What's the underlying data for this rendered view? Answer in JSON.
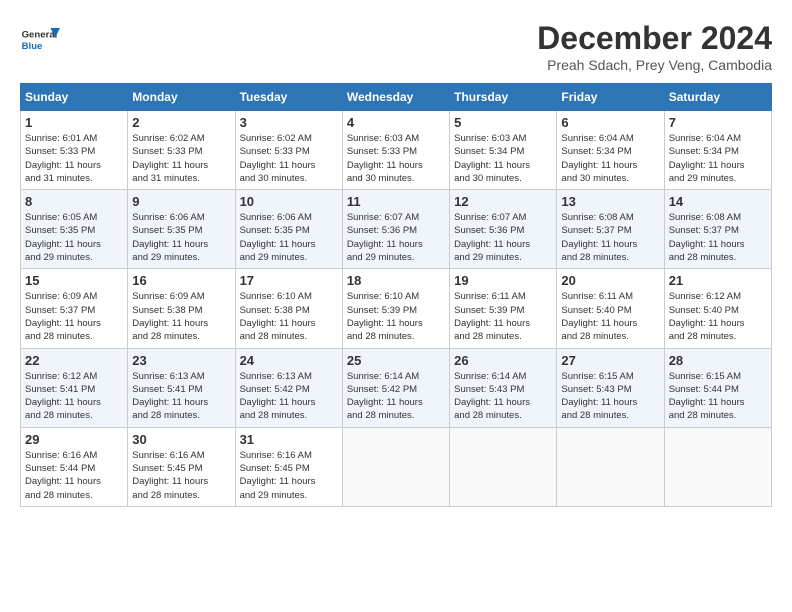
{
  "header": {
    "logo_general": "General",
    "logo_blue": "Blue",
    "title": "December 2024",
    "subtitle": "Preah Sdach, Prey Veng, Cambodia"
  },
  "calendar": {
    "days_of_week": [
      "Sunday",
      "Monday",
      "Tuesday",
      "Wednesday",
      "Thursday",
      "Friday",
      "Saturday"
    ],
    "weeks": [
      [
        {
          "day": "",
          "info": ""
        },
        {
          "day": "2",
          "info": "Sunrise: 6:02 AM\nSunset: 5:33 PM\nDaylight: 11 hours\nand 31 minutes."
        },
        {
          "day": "3",
          "info": "Sunrise: 6:02 AM\nSunset: 5:33 PM\nDaylight: 11 hours\nand 30 minutes."
        },
        {
          "day": "4",
          "info": "Sunrise: 6:03 AM\nSunset: 5:33 PM\nDaylight: 11 hours\nand 30 minutes."
        },
        {
          "day": "5",
          "info": "Sunrise: 6:03 AM\nSunset: 5:34 PM\nDaylight: 11 hours\nand 30 minutes."
        },
        {
          "day": "6",
          "info": "Sunrise: 6:04 AM\nSunset: 5:34 PM\nDaylight: 11 hours\nand 30 minutes."
        },
        {
          "day": "7",
          "info": "Sunrise: 6:04 AM\nSunset: 5:34 PM\nDaylight: 11 hours\nand 29 minutes."
        }
      ],
      [
        {
          "day": "1",
          "info": "Sunrise: 6:01 AM\nSunset: 5:33 PM\nDaylight: 11 hours\nand 31 minutes."
        },
        {
          "day": "",
          "info": ""
        },
        {
          "day": "",
          "info": ""
        },
        {
          "day": "",
          "info": ""
        },
        {
          "day": "",
          "info": ""
        },
        {
          "day": "",
          "info": ""
        },
        {
          "day": "",
          "info": ""
        }
      ],
      [
        {
          "day": "8",
          "info": "Sunrise: 6:05 AM\nSunset: 5:35 PM\nDaylight: 11 hours\nand 29 minutes."
        },
        {
          "day": "9",
          "info": "Sunrise: 6:06 AM\nSunset: 5:35 PM\nDaylight: 11 hours\nand 29 minutes."
        },
        {
          "day": "10",
          "info": "Sunrise: 6:06 AM\nSunset: 5:35 PM\nDaylight: 11 hours\nand 29 minutes."
        },
        {
          "day": "11",
          "info": "Sunrise: 6:07 AM\nSunset: 5:36 PM\nDaylight: 11 hours\nand 29 minutes."
        },
        {
          "day": "12",
          "info": "Sunrise: 6:07 AM\nSunset: 5:36 PM\nDaylight: 11 hours\nand 29 minutes."
        },
        {
          "day": "13",
          "info": "Sunrise: 6:08 AM\nSunset: 5:37 PM\nDaylight: 11 hours\nand 28 minutes."
        },
        {
          "day": "14",
          "info": "Sunrise: 6:08 AM\nSunset: 5:37 PM\nDaylight: 11 hours\nand 28 minutes."
        }
      ],
      [
        {
          "day": "15",
          "info": "Sunrise: 6:09 AM\nSunset: 5:37 PM\nDaylight: 11 hours\nand 28 minutes."
        },
        {
          "day": "16",
          "info": "Sunrise: 6:09 AM\nSunset: 5:38 PM\nDaylight: 11 hours\nand 28 minutes."
        },
        {
          "day": "17",
          "info": "Sunrise: 6:10 AM\nSunset: 5:38 PM\nDaylight: 11 hours\nand 28 minutes."
        },
        {
          "day": "18",
          "info": "Sunrise: 6:10 AM\nSunset: 5:39 PM\nDaylight: 11 hours\nand 28 minutes."
        },
        {
          "day": "19",
          "info": "Sunrise: 6:11 AM\nSunset: 5:39 PM\nDaylight: 11 hours\nand 28 minutes."
        },
        {
          "day": "20",
          "info": "Sunrise: 6:11 AM\nSunset: 5:40 PM\nDaylight: 11 hours\nand 28 minutes."
        },
        {
          "day": "21",
          "info": "Sunrise: 6:12 AM\nSunset: 5:40 PM\nDaylight: 11 hours\nand 28 minutes."
        }
      ],
      [
        {
          "day": "22",
          "info": "Sunrise: 6:12 AM\nSunset: 5:41 PM\nDaylight: 11 hours\nand 28 minutes."
        },
        {
          "day": "23",
          "info": "Sunrise: 6:13 AM\nSunset: 5:41 PM\nDaylight: 11 hours\nand 28 minutes."
        },
        {
          "day": "24",
          "info": "Sunrise: 6:13 AM\nSunset: 5:42 PM\nDaylight: 11 hours\nand 28 minutes."
        },
        {
          "day": "25",
          "info": "Sunrise: 6:14 AM\nSunset: 5:42 PM\nDaylight: 11 hours\nand 28 minutes."
        },
        {
          "day": "26",
          "info": "Sunrise: 6:14 AM\nSunset: 5:43 PM\nDaylight: 11 hours\nand 28 minutes."
        },
        {
          "day": "27",
          "info": "Sunrise: 6:15 AM\nSunset: 5:43 PM\nDaylight: 11 hours\nand 28 minutes."
        },
        {
          "day": "28",
          "info": "Sunrise: 6:15 AM\nSunset: 5:44 PM\nDaylight: 11 hours\nand 28 minutes."
        }
      ],
      [
        {
          "day": "29",
          "info": "Sunrise: 6:16 AM\nSunset: 5:44 PM\nDaylight: 11 hours\nand 28 minutes."
        },
        {
          "day": "30",
          "info": "Sunrise: 6:16 AM\nSunset: 5:45 PM\nDaylight: 11 hours\nand 28 minutes."
        },
        {
          "day": "31",
          "info": "Sunrise: 6:16 AM\nSunset: 5:45 PM\nDaylight: 11 hours\nand 29 minutes."
        },
        {
          "day": "",
          "info": ""
        },
        {
          "day": "",
          "info": ""
        },
        {
          "day": "",
          "info": ""
        },
        {
          "day": "",
          "info": ""
        }
      ]
    ]
  }
}
